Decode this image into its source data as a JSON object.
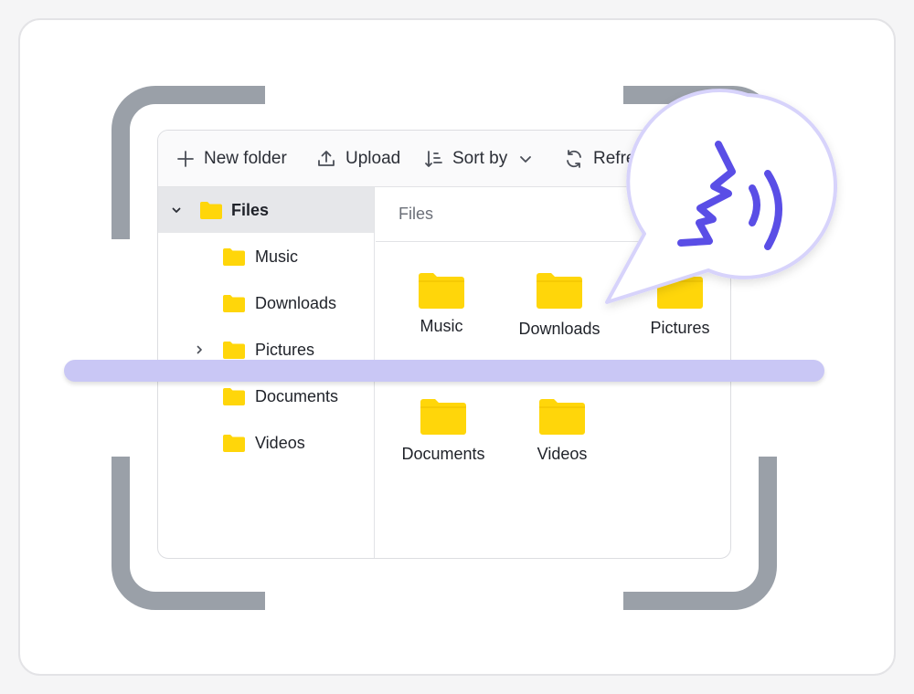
{
  "toolbar": {
    "new_folder": "New folder",
    "upload": "Upload",
    "sort_by": "Sort by",
    "refresh": "Refre"
  },
  "sidebar": {
    "root": {
      "label": "Files",
      "expanded": true
    },
    "items": [
      {
        "label": "Music",
        "has_children": false
      },
      {
        "label": "Downloads",
        "has_children": false
      },
      {
        "label": "Pictures",
        "has_children": true
      },
      {
        "label": "Documents",
        "has_children": false
      },
      {
        "label": "Videos",
        "has_children": false
      }
    ]
  },
  "content": {
    "breadcrumb": "Files",
    "folders": [
      {
        "label": "Music"
      },
      {
        "label": "Downloads"
      },
      {
        "label": "Pictures"
      },
      {
        "label": "Documents"
      },
      {
        "label": "Videos"
      }
    ]
  },
  "colors": {
    "folder": "#ffd60a",
    "bracket": "#9aa0a8",
    "scanline": "#c9c7f5",
    "accent": "#5a4ee6",
    "bubble_border": "#d7d3fb"
  },
  "icons": {
    "new_folder": "plus-icon",
    "upload": "upload-icon",
    "sort": "sort-icon",
    "refresh": "refresh-icon",
    "bubble": "speaking-head-icon"
  }
}
